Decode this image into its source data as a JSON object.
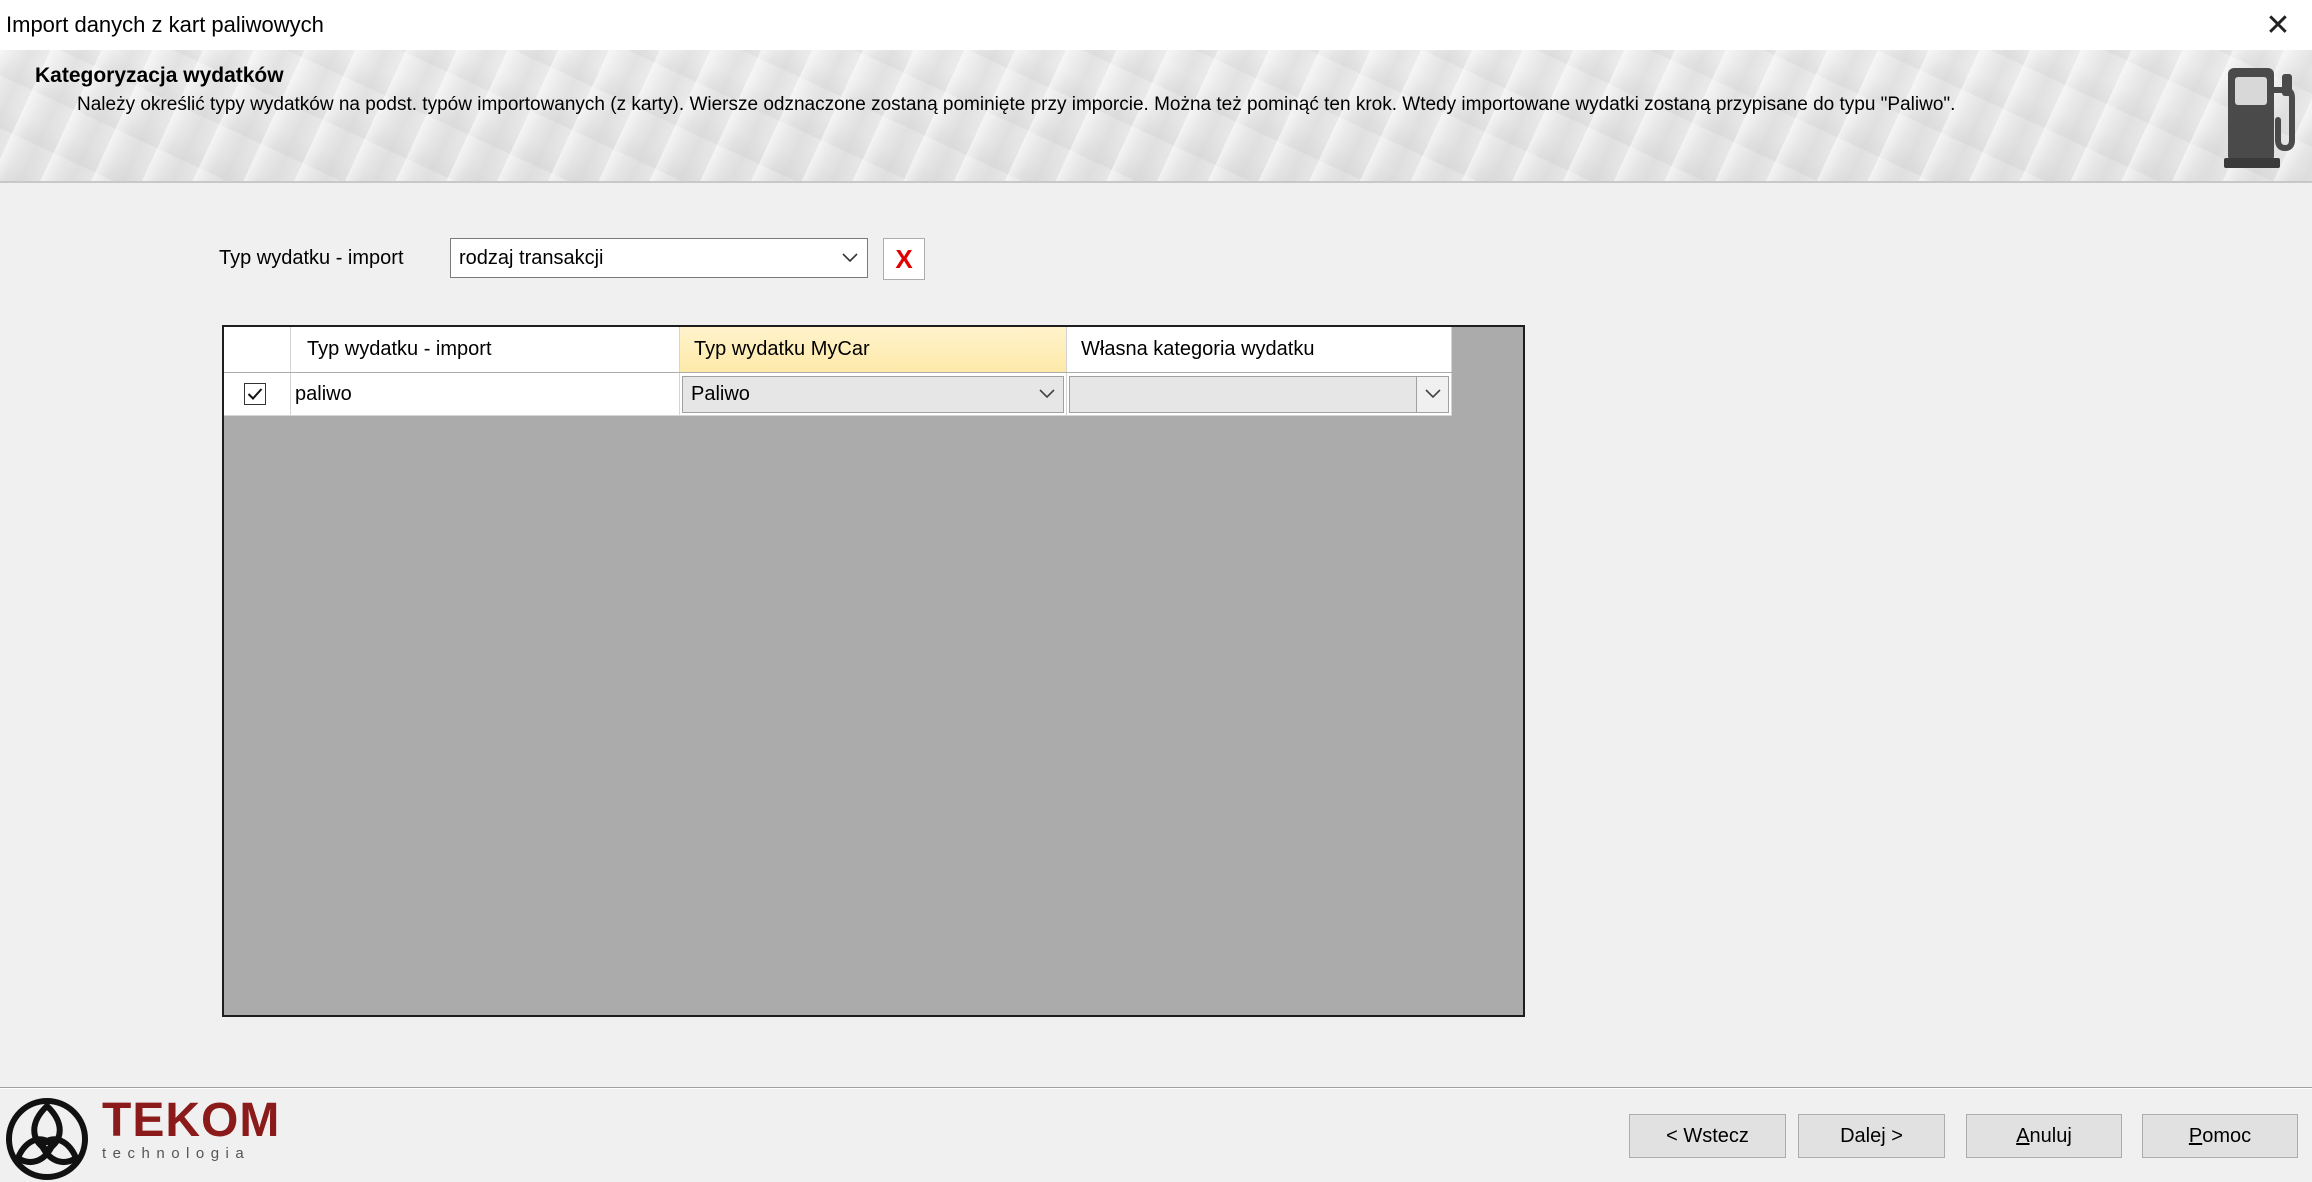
{
  "window": {
    "title": "Import danych z kart paliwowych",
    "close_glyph": "✕"
  },
  "header": {
    "title": "Kategoryzacja wydatków",
    "description": "Należy określić typy wydatków na podst. typów importowanych (z karty). Wiersze odznaczone zostaną pominięte przy imporcie. Można też pominąć ten krok. Wtedy importowane wydatki zostaną przypisane do typu \"Paliwo\".",
    "icon": "fuel-pump-icon"
  },
  "filter": {
    "label": "Typ wydatku - import",
    "selected": "rodzaj transakcji",
    "clear_glyph": "X"
  },
  "grid": {
    "columns": [
      "Typ wydatku - import",
      "Typ wydatku MyCar",
      "Własna kategoria wydatku"
    ],
    "active_column": 1,
    "rows": [
      {
        "checked": true,
        "import_type": "paliwo",
        "mycar_type": "Paliwo",
        "own_category": ""
      }
    ]
  },
  "logo": {
    "brand": "TEKOM",
    "sub": "technologia"
  },
  "buttons": {
    "back": "< Wstecz",
    "next": "Dalej >",
    "cancel_first": "A",
    "cancel_rest": "nuluj",
    "help_first": "P",
    "help_rest": "omoc"
  }
}
